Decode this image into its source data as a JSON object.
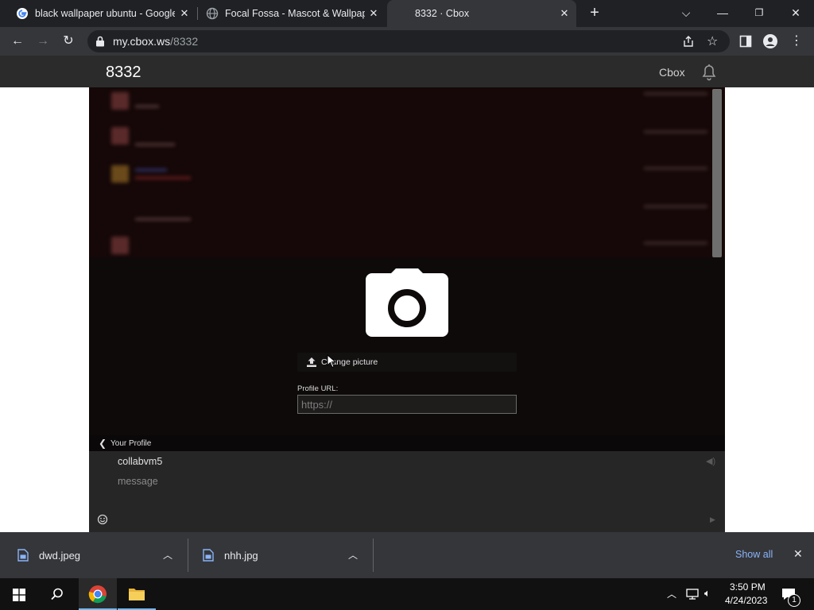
{
  "tabs": [
    {
      "title": "black wallpaper ubuntu - Google",
      "active": false,
      "favicon": "google-g-icon"
    },
    {
      "title": "Focal Fossa - Mascot & Wallpape",
      "active": false,
      "favicon": "globe-icon"
    },
    {
      "title": "8332 · Cbox",
      "active": true,
      "favicon": "none"
    }
  ],
  "new_tab_label": "+",
  "address_bar": {
    "domain": "my.cbox.ws",
    "path": "/8332"
  },
  "header": {
    "box_title": "8332",
    "brand": "Cbox"
  },
  "profile_editor": {
    "change_picture_label": "Change picture",
    "profile_url_label": "Profile URL:",
    "profile_url_placeholder": "https://"
  },
  "profile_bar": {
    "label": "Your Profile"
  },
  "composer": {
    "username": "collabvm5",
    "message_placeholder": "message"
  },
  "downloads": {
    "items": [
      {
        "name": "dwd.jpeg"
      },
      {
        "name": "nhh.jpg"
      }
    ],
    "show_all_label": "Show all"
  },
  "taskbar": {
    "time": "3:50 PM",
    "date": "4/24/2023",
    "notification_count": "1"
  },
  "colors": {
    "accent_link": "#8ab4f8",
    "header_bg": "#2b2b2b",
    "chat_bg": "#0e0a0a"
  }
}
